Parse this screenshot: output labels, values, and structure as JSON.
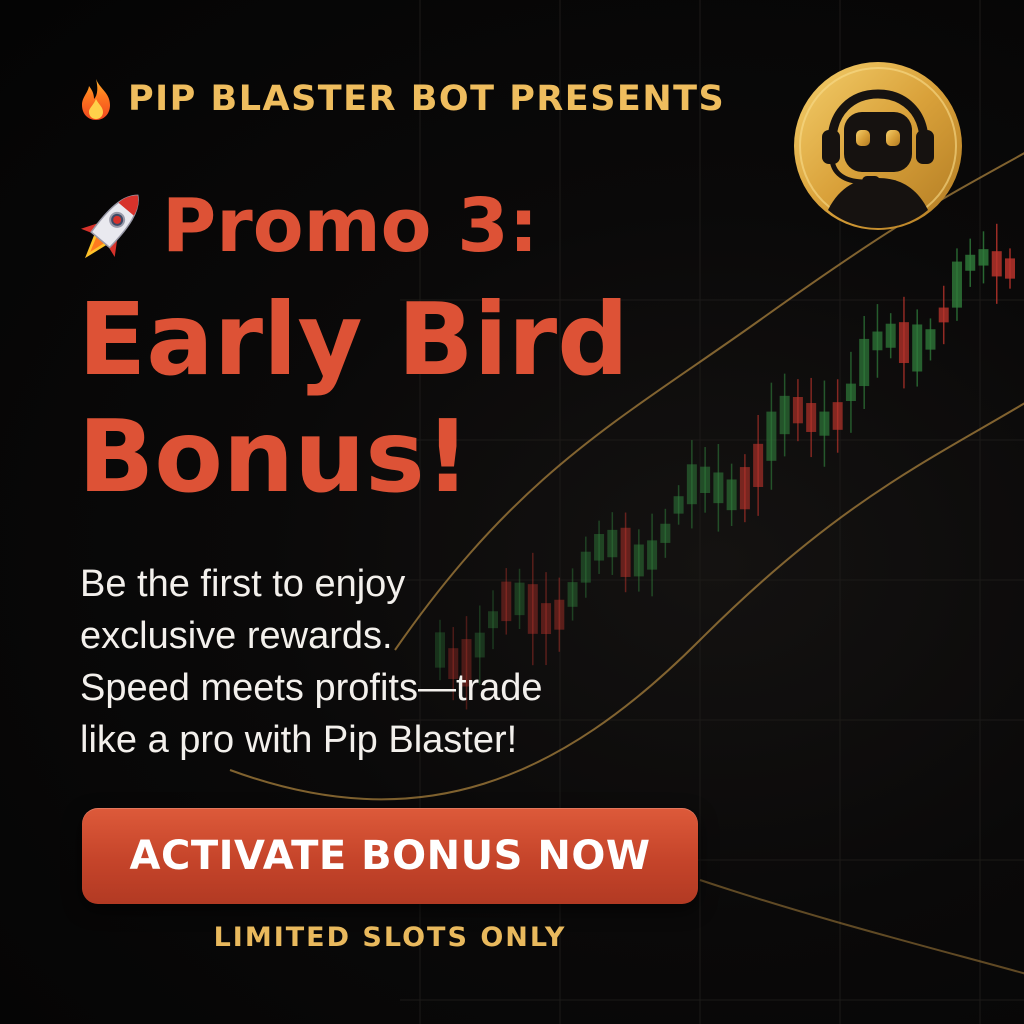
{
  "eyebrow": {
    "icon": "fire-icon",
    "text": "PIP BLASTER BOT PRESENTS"
  },
  "headline": {
    "icon": "rocket-icon",
    "line1": "Promo 3:",
    "line2": "Early Bird",
    "line3": "Bonus!"
  },
  "body": {
    "text": "Be the first to enjoy\nexclusive rewards.\nSpeed meets profits—trade\nlike a pro with Pip Blaster!"
  },
  "cta": {
    "label": "ACTIVATE BONUS NOW"
  },
  "footnote": {
    "text": "LIMITED SLOTS ONLY"
  },
  "logo": {
    "icon": "robot-headset-icon"
  },
  "colors": {
    "background": "#060606",
    "accent_red": "#dd5236",
    "accent_gold": "#efbd5e",
    "candle_up": "#2f7a3a",
    "candle_down": "#b8332b",
    "body_text": "#f3f0ec"
  }
}
